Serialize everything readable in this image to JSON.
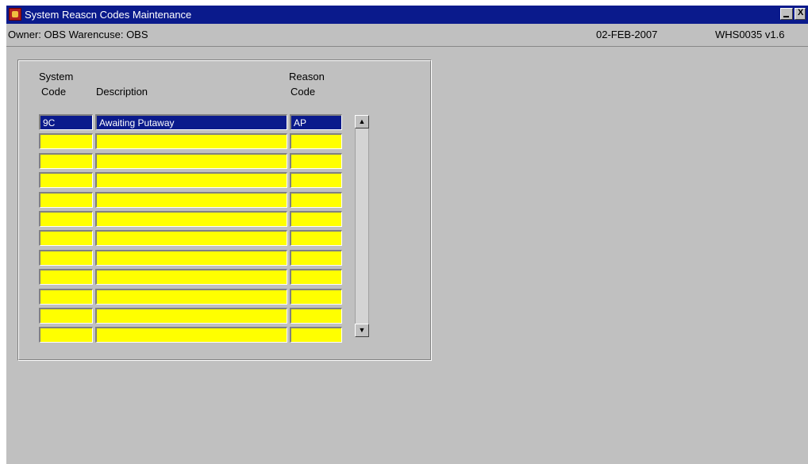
{
  "window": {
    "title": "System Reascn Codes Maintenance"
  },
  "status": {
    "owner_line": "Owner: OBS  Warencuse: OBS",
    "date": "02-FEB-2007",
    "version": "WHS0035 v1.6"
  },
  "columns": {
    "system_code_line1": "System",
    "system_code_line2": "Code",
    "description": "Description",
    "reason_code_line1": "Reason",
    "reason_code_line2": "Code"
  },
  "rows": [
    {
      "system_code": "9C",
      "description": "Awaiting Putaway",
      "reason_code": "AP",
      "selected": true
    },
    {
      "system_code": "",
      "description": "",
      "reason_code": ""
    },
    {
      "system_code": "",
      "description": "",
      "reason_code": ""
    },
    {
      "system_code": "",
      "description": "",
      "reason_code": ""
    },
    {
      "system_code": "",
      "description": "",
      "reason_code": ""
    },
    {
      "system_code": "",
      "description": "",
      "reason_code": ""
    },
    {
      "system_code": "",
      "description": "",
      "reason_code": ""
    },
    {
      "system_code": "",
      "description": "",
      "reason_code": ""
    },
    {
      "system_code": "",
      "description": "",
      "reason_code": ""
    },
    {
      "system_code": "",
      "description": "",
      "reason_code": ""
    },
    {
      "system_code": "",
      "description": "",
      "reason_code": ""
    },
    {
      "system_code": "",
      "description": "",
      "reason_code": ""
    }
  ],
  "scrollbar": {
    "up_icon": "▲",
    "down_icon": "▼"
  },
  "colors": {
    "field": "#ffff00",
    "selection": "#0a1a8c",
    "background": "#c0c0c0"
  }
}
